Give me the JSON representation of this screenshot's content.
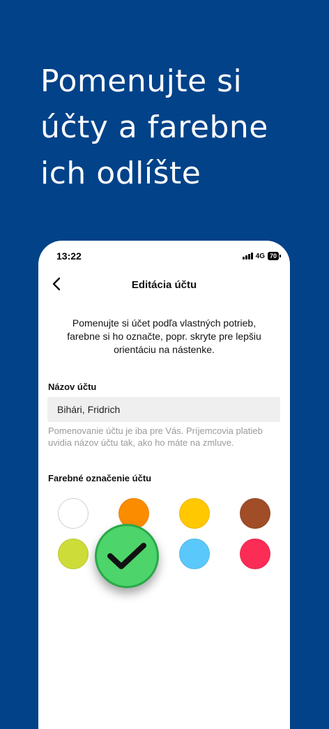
{
  "promo": {
    "headline_lines": [
      "Pomenujte si",
      "účty a farebne",
      "ich odlíšte"
    ]
  },
  "status_bar": {
    "time": "13:22",
    "network": "4G",
    "battery": "70"
  },
  "nav": {
    "title": "Editácia účtu",
    "back_icon": "chevron-left-icon"
  },
  "intro_text": "Pomenujte si účet podľa vlastných potrieb, farebne si ho označte, popr. skryte pre lepšiu orientáciu na nástenke.",
  "account_name": {
    "label": "Názov účtu",
    "value": "Bihári, Fridrich",
    "hint": "Pomenovanie účtu je iba pre Vás. Príjemcovia platieb uvidia názov účtu tak, ako ho máte na zmluve."
  },
  "color_section": {
    "label": "Farebné označenie účtu",
    "colors": [
      {
        "name": "white",
        "hex": "#ffffff"
      },
      {
        "name": "orange",
        "hex": "#fb8c00"
      },
      {
        "name": "yellow",
        "hex": "#ffc800"
      },
      {
        "name": "brown",
        "hex": "#a04d28"
      },
      {
        "name": "lime",
        "hex": "#cddc39"
      },
      {
        "name": "green",
        "hex": "#4dd46a"
      },
      {
        "name": "light-blue",
        "hex": "#5ac8fa"
      },
      {
        "name": "red",
        "hex": "#fb2c55"
      }
    ],
    "selected": "green"
  }
}
